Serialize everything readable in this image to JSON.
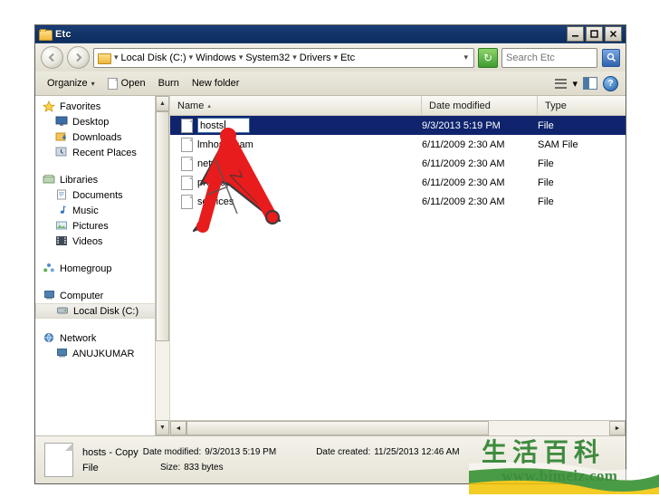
{
  "window": {
    "title": "Etc",
    "folder_icon": "folder-icon",
    "minimize_label": "–",
    "maximize_label": "□",
    "close_label": "✕"
  },
  "navigation": {
    "back_label": "←",
    "forward_label": "→",
    "address_icon": "folder-icon",
    "breadcrumbs": [
      "Local Disk (C:)",
      "Windows",
      "System32",
      "Drivers",
      "Etc"
    ],
    "separator": "▾",
    "dropdown": "▾",
    "refresh_label": "↻",
    "search_placeholder": "Search Etc",
    "search_value": "",
    "search_icon": "magnifier-icon"
  },
  "toolbar": {
    "organize_label": "Organize",
    "organize_caret": "▾",
    "open_label": "Open",
    "burn_label": "Burn",
    "new_folder_label": "New folder",
    "view_caret": "▾",
    "view_icon": "view-list-icon",
    "preview_icon": "preview-pane-icon",
    "help_icon": "help-icon",
    "help_label": "?"
  },
  "sidebar": {
    "groups": [
      {
        "header": {
          "label": "Favorites",
          "icon": "star-icon"
        },
        "items": [
          {
            "label": "Desktop",
            "icon": "desktop-icon"
          },
          {
            "label": "Downloads",
            "icon": "downloads-icon"
          },
          {
            "label": "Recent Places",
            "icon": "recent-places-icon"
          }
        ]
      },
      {
        "header": {
          "label": "Libraries",
          "icon": "libraries-icon"
        },
        "items": [
          {
            "label": "Documents",
            "icon": "documents-icon"
          },
          {
            "label": "Music",
            "icon": "music-icon"
          },
          {
            "label": "Pictures",
            "icon": "pictures-icon"
          },
          {
            "label": "Videos",
            "icon": "videos-icon"
          }
        ]
      },
      {
        "header": {
          "label": "Homegroup",
          "icon": "homegroup-icon"
        },
        "items": []
      },
      {
        "header": {
          "label": "Computer",
          "icon": "computer-icon"
        },
        "items": [
          {
            "label": "Local Disk (C:)",
            "icon": "hard-disk-icon",
            "selected": true
          }
        ]
      },
      {
        "header": {
          "label": "Network",
          "icon": "network-icon"
        },
        "items": [
          {
            "label": "ANUJKUMAR",
            "icon": "computer-icon"
          }
        ]
      }
    ],
    "scroll_up": "▲",
    "scroll_down": "▼"
  },
  "filelist": {
    "columns": [
      {
        "label": "Name",
        "sort": "▴"
      },
      {
        "label": "Date modified",
        "sort": ""
      },
      {
        "label": "Type",
        "sort": ""
      }
    ],
    "rows": [
      {
        "name": "hosts",
        "date_modified": "9/3/2013 5:19 PM",
        "type": "File",
        "selected": true,
        "renaming": true
      },
      {
        "name": "lmhosts.sam",
        "date_modified": "6/11/2009 2:30 AM",
        "type": "SAM File",
        "selected": false,
        "renaming": false
      },
      {
        "name": "networks",
        "date_modified": "6/11/2009 2:30 AM",
        "type": "File",
        "selected": false,
        "renaming": false
      },
      {
        "name": "protocol",
        "date_modified": "6/11/2009 2:30 AM",
        "type": "File",
        "selected": false,
        "renaming": false
      },
      {
        "name": "services",
        "date_modified": "6/11/2009 2:30 AM",
        "type": "File",
        "selected": false,
        "renaming": false
      }
    ],
    "scroll_left": "◄",
    "scroll_right": "►"
  },
  "statusbar": {
    "file_name": "hosts - Copy",
    "date_modified_label": "Date modified:",
    "date_modified_value": "9/3/2013 5:19 PM",
    "date_created_label": "Date created:",
    "date_created_value": "11/25/2013 12:46 AM",
    "file_type": "File",
    "size_label": "Size:",
    "size_value": "833 bytes",
    "icon": "file-icon"
  },
  "watermark": {
    "cjk_text": "生活百科",
    "url": "www.bimeiz.com"
  },
  "annotation": {
    "type": "red-arrow",
    "color": "#e81c1c"
  },
  "colors": {
    "titlebar": "#12356a",
    "selection": "#10246e",
    "chrome": "#e6e3d6",
    "annotation_red": "#e81c1c"
  }
}
